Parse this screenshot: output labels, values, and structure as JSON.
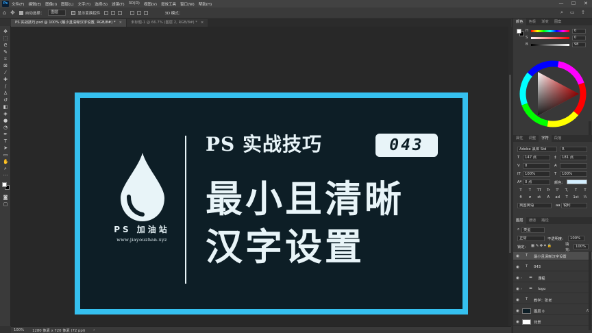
{
  "app": {
    "logo": "Ps"
  },
  "menu": [
    "文件(F)",
    "编辑(E)",
    "图像(I)",
    "图层(L)",
    "文字(Y)",
    "选择(S)",
    "滤镜(T)",
    "3D(D)",
    "视图(V)",
    "增效工具",
    "窗口(W)",
    "帮助(H)"
  ],
  "window_controls": {
    "minimize": "—",
    "maximize": "☐",
    "close": "✕"
  },
  "options": {
    "auto_select_label": "自动选择：",
    "auto_select_value": "图层",
    "show_transform_label": "显示变换控件",
    "mode_3d": "3D 模式："
  },
  "tabs": [
    {
      "title": "PS 实战技巧.psd @ 100% (最小且清晰汉字设置, RGB/8#) *",
      "active": true
    },
    {
      "title": "未标题-1 @ 66.7% (图层 2, RGB/8#) *",
      "active": false
    }
  ],
  "artwork": {
    "site_name": "PS 加油站",
    "site_url": "www.jiayouzhan.xyz",
    "title_ps": "PS 实战技巧",
    "episode": "043",
    "line1": "最小且清晰",
    "line2": "汉字设置"
  },
  "status": {
    "zoom": "100%",
    "doc_size": "1280 像素 x 720 像素 (72 ppi)"
  },
  "color_panel": {
    "tabs": [
      "颜色",
      "色板",
      "渐变",
      "图案"
    ],
    "sliders": [
      {
        "label": "H",
        "value": "0"
      },
      {
        "label": "S",
        "value": "0"
      },
      {
        "label": "B",
        "value": "98"
      }
    ]
  },
  "properties_panel": {
    "tabs": [
      "属性",
      "调整",
      "字符",
      "段落"
    ],
    "font_family": "Adobe 黑体 Std",
    "font_style": "R",
    "font_size": "147 点",
    "leading": "181 点",
    "kerning": "0",
    "tracking": "",
    "vscale": "100%",
    "hscale": "100%",
    "baseline": "0 点",
    "color_label": "颜色:",
    "text_color": "#d4efff",
    "language": "英国英语",
    "antialias": "锐利",
    "aa_prefix": "aa",
    "style_glyphs": [
      "T",
      "T",
      "TT",
      "Tr",
      "T'",
      "T,",
      "T",
      "T"
    ],
    "ot_glyphs": [
      "fi",
      "σ",
      "st",
      "A",
      "ad",
      "T",
      "1st",
      "½"
    ]
  },
  "layers_panel": {
    "tabs": [
      "图层",
      "通道",
      "路径"
    ],
    "filter_label": "类型",
    "blend_mode": "正常",
    "opacity_label": "不透明度:",
    "opacity": "100%",
    "lock_label": "锁定:",
    "fill_label": "填充:",
    "fill": "100%",
    "layers": [
      {
        "name": "最小且清晰汉字设置",
        "kind": "text",
        "thumb": "T",
        "selected": true,
        "fx": false,
        "indent": 0
      },
      {
        "name": "043",
        "kind": "text",
        "thumb": "T",
        "selected": false,
        "fx": false,
        "indent": 0
      },
      {
        "name": "课程",
        "kind": "group",
        "thumb": "▬",
        "selected": false,
        "fx": false,
        "indent": 0
      },
      {
        "name": "logo",
        "kind": "group",
        "thumb": "▬",
        "selected": false,
        "fx": false,
        "indent": 0
      },
      {
        "name": "教学：张老",
        "kind": "text",
        "thumb": "T",
        "selected": false,
        "fx": false,
        "indent": 0
      },
      {
        "name": "图层 0",
        "kind": "pixel",
        "thumb": "",
        "selected": false,
        "fx": true,
        "indent": 0
      },
      {
        "name": "背景",
        "kind": "pixel",
        "thumb": "",
        "selected": false,
        "fx": false,
        "indent": 0
      }
    ]
  },
  "colors": {
    "accent_border": "#35c0ef",
    "artwork_bg": "#0d1e26",
    "artwork_text": "#e8f4f8"
  }
}
